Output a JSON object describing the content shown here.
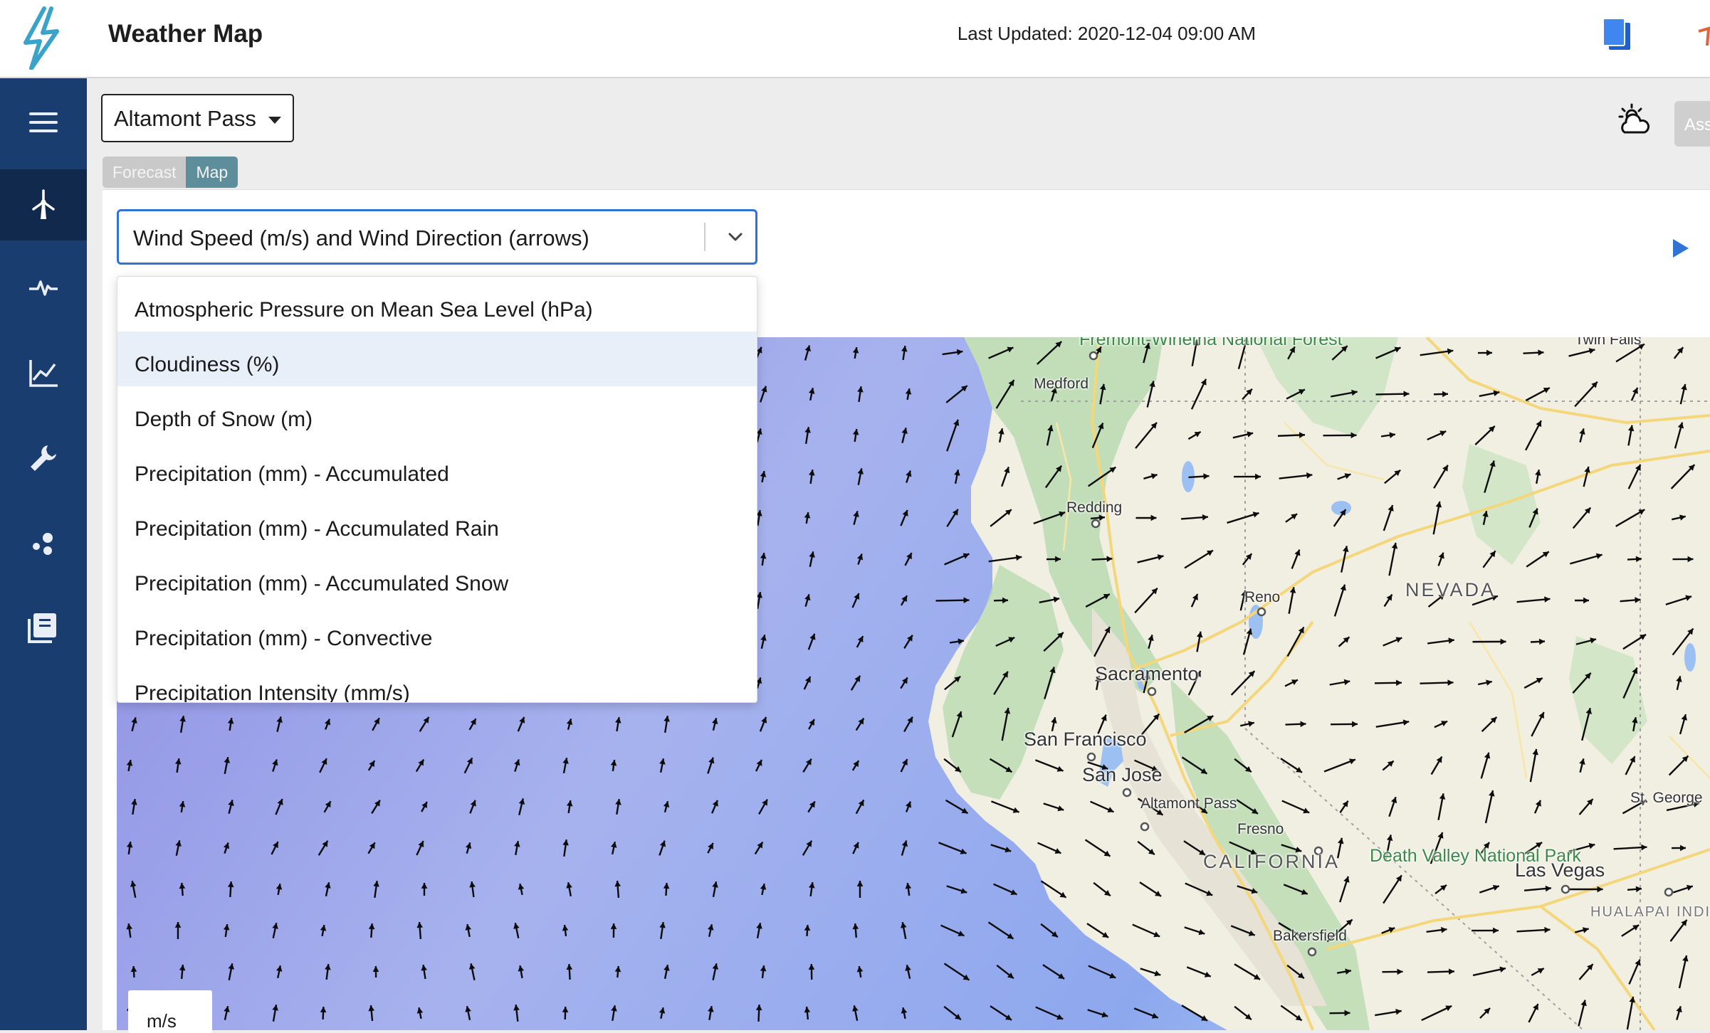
{
  "header": {
    "title": "Weather Map",
    "last_updated": "Last Updated: 2020-12-04 09:00 AM",
    "logo_icon": "lightning-bolt-logo",
    "book_icon": "document-stack-icon"
  },
  "sidebar": {
    "items": [
      {
        "icon": "hamburger-menu-icon"
      },
      {
        "icon": "wind-turbine-icon",
        "active": true
      },
      {
        "icon": "pulse-icon"
      },
      {
        "icon": "line-chart-icon"
      },
      {
        "icon": "wrench-icon"
      },
      {
        "icon": "dots-cluster-icon"
      },
      {
        "icon": "reports-icon"
      }
    ]
  },
  "site_selector": {
    "value": "Altamont Pass"
  },
  "assist_button": {
    "label": "Ass"
  },
  "tabs": [
    {
      "label": "Forecast",
      "active": false
    },
    {
      "label": "Map",
      "active": true
    }
  ],
  "variable_select": {
    "value": "Wind Speed (m/s) and Wind Direction (arrows)",
    "options": [
      "Atmospheric Pressure on Mean Sea Level (hPa)",
      "Cloudiness (%)",
      "Depth of Snow (m)",
      "Precipitation (mm) - Accumulated",
      "Precipitation (mm) - Accumulated Rain",
      "Precipitation (mm) - Accumulated Snow",
      "Precipitation (mm) - Convective",
      "Precipitation Intensity (mm/s)"
    ],
    "highlighted_index": 1
  },
  "map": {
    "labels": {
      "medford": "Medford",
      "forest": "Fremont-Winema National Forest",
      "twin_falls": "Twin Falls",
      "redding": "Redding",
      "reno": "Reno",
      "nevada": "NEVADA",
      "sacramento": "Sacramento",
      "san_francisco": "San Francisco",
      "san_jose": "San Jose",
      "altamont": "Altamont Pass",
      "fresno": "Fresno",
      "california": "CALIFORNIA",
      "death_valley": "Death Valley National Park",
      "las_vegas": "Las Vegas",
      "st_george": "St. George",
      "hualapai": "HUALAPAI INDIAN RESERVATION",
      "bakersfield": "Bakersfield"
    },
    "legend_unit": "m/s"
  },
  "colors": {
    "sidebar": "#1a3d6f",
    "sidebar_active": "#10294d",
    "select_border": "#2f73d6",
    "tab_active": "#5e8e9b",
    "ocean": "#8c9ae6",
    "land": "#f2efe4"
  }
}
